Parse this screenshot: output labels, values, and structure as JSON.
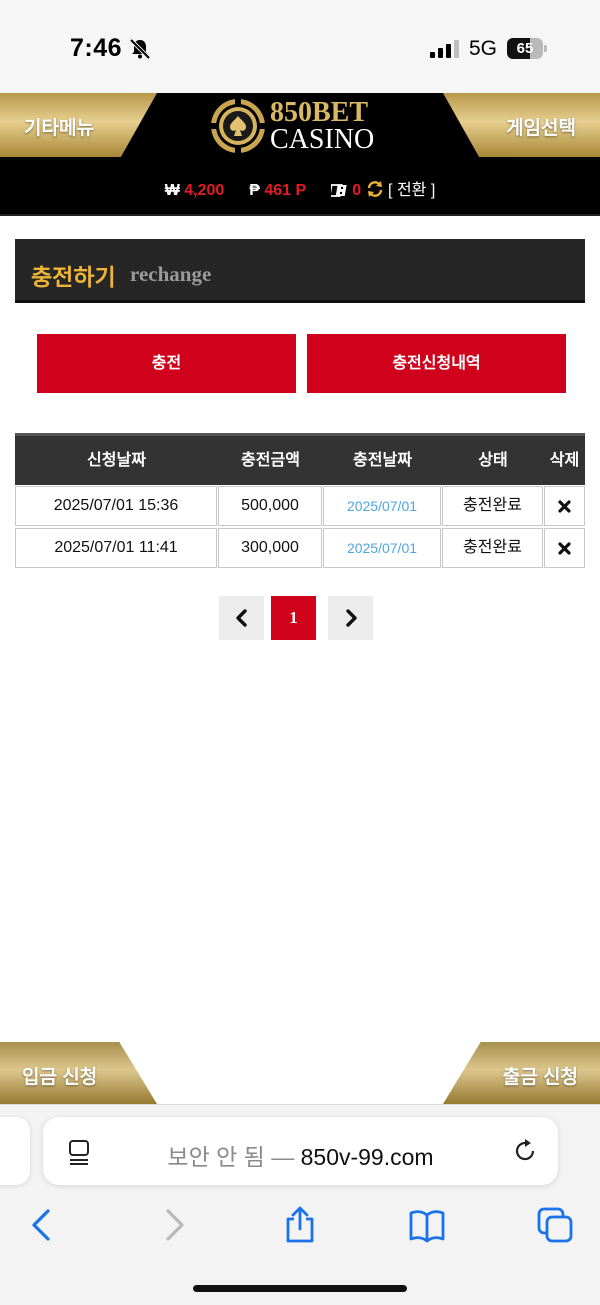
{
  "status_bar": {
    "time": "7:46",
    "network": "5G",
    "battery": "65",
    "battery_level": 0.65
  },
  "header": {
    "left_menu": "기타메뉴",
    "right_menu": "게임선택",
    "logo_line1": "850BET",
    "logo_line2": "CASINO",
    "gold_color": "#d9b864"
  },
  "balance": {
    "won_symbol": "₩",
    "won_value": "4,200",
    "point_symbol": "₱",
    "point_value": "461 P",
    "chip_value": "0",
    "convert_label": "[ 전환 ]"
  },
  "section": {
    "title_ko": "충전하기",
    "title_en": "rechange",
    "accent_color": "#f0b537"
  },
  "actions": {
    "charge_label": "충전",
    "history_label": "충전신청내역",
    "button_color": "#d0021b"
  },
  "table": {
    "headers": [
      "신청날짜",
      "충전금액",
      "충전날짜",
      "상태",
      "삭제"
    ],
    "rows": [
      {
        "request_date": "2025/07/01 15:36",
        "amount": "500,000",
        "charge_date": "2025/07/01",
        "status": "충전완료"
      },
      {
        "request_date": "2025/07/01 11:41",
        "amount": "300,000",
        "charge_date": "2025/07/01",
        "status": "충전완료"
      }
    ]
  },
  "pagination": {
    "current_page": "1"
  },
  "floating_tabs": {
    "deposit_label": "입금 신청",
    "withdraw_label": "출금 신청"
  },
  "browser": {
    "security_label": "보안 안 됨 — ",
    "host": "850v-99.com"
  }
}
